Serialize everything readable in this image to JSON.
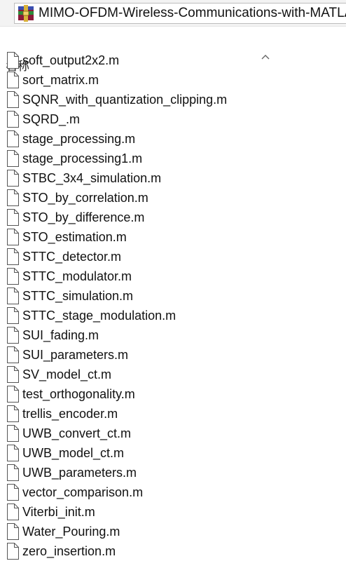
{
  "window": {
    "title": "MIMO-OFDM-Wireless-Communications-with-MATLAB"
  },
  "header": {
    "name_column": "名称",
    "sort_indicator_icon": "chevron-up-icon"
  },
  "icons": {
    "app": "winrar-archive-icon",
    "file": "file-icon"
  },
  "files": [
    "soft_output2x2.m",
    "sort_matrix.m",
    "SQNR_with_quantization_clipping.m",
    "SQRD_.m",
    "stage_processing.m",
    "stage_processing1.m",
    "STBC_3x4_simulation.m",
    "STO_by_correlation.m",
    "STO_by_difference.m",
    "STO_estimation.m",
    "STTC_detector.m",
    "STTC_modulator.m",
    "STTC_simulation.m",
    "STTC_stage_modulation.m",
    "SUI_fading.m",
    "SUI_parameters.m",
    "SV_model_ct.m",
    "test_orthogonality.m",
    "trellis_encoder.m",
    "UWB_convert_ct.m",
    "UWB_model_ct.m",
    "UWB_parameters.m",
    "vector_comparison.m",
    "Viterbi_init.m",
    "Water_Pouring.m",
    "zero_insertion.m"
  ]
}
